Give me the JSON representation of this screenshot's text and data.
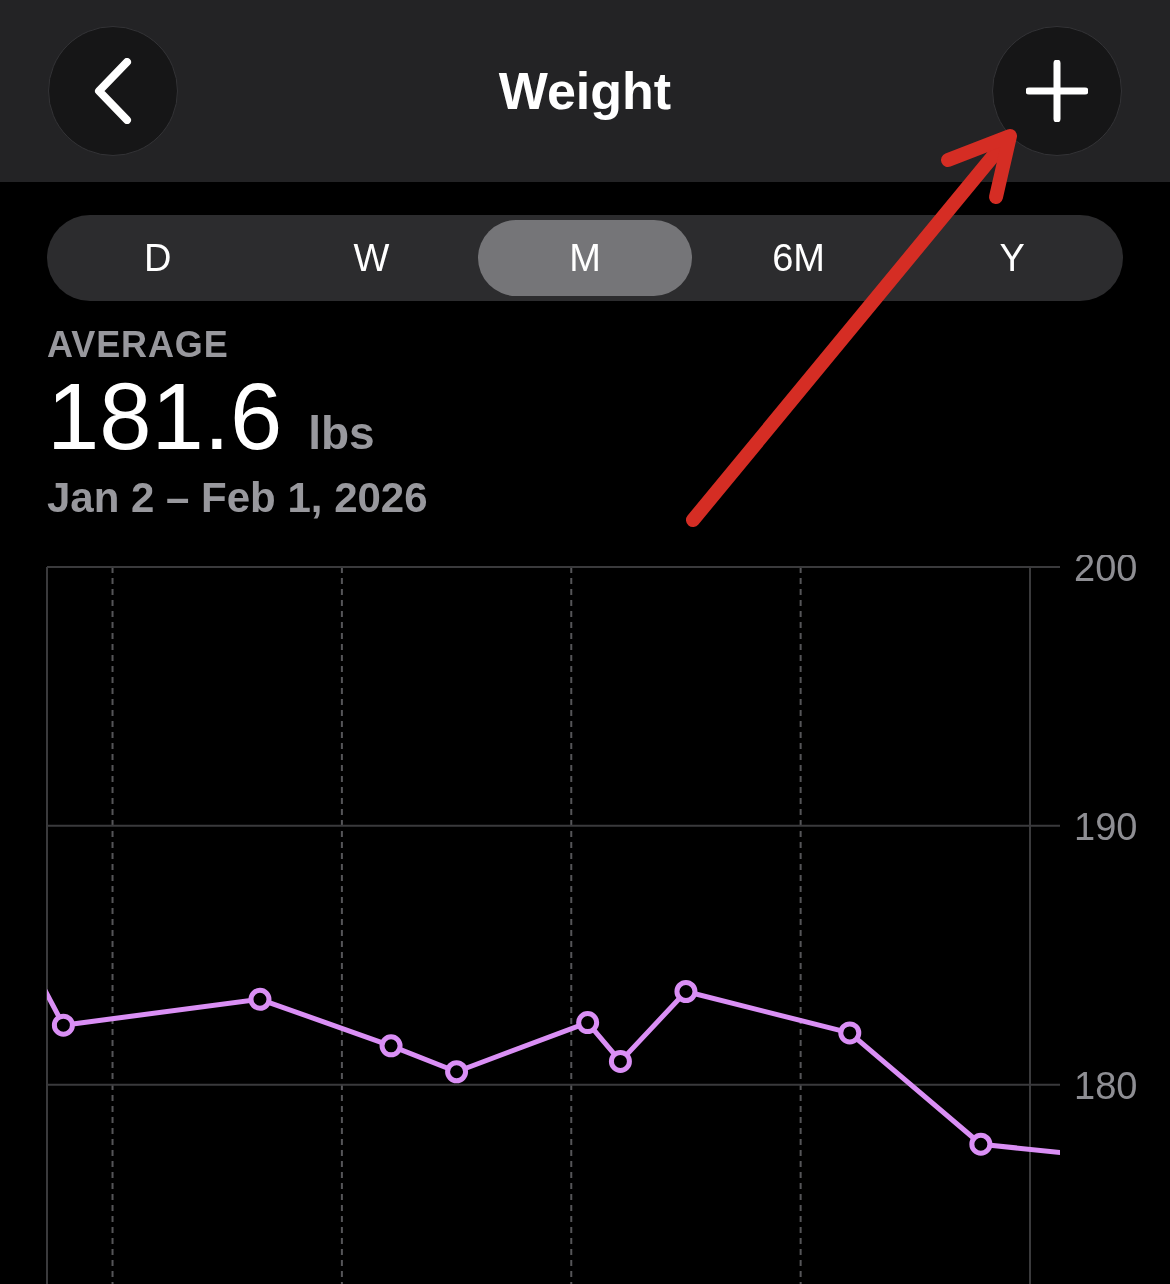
{
  "header": {
    "title": "Weight"
  },
  "ranges": [
    {
      "label": "D",
      "selected": false
    },
    {
      "label": "W",
      "selected": false
    },
    {
      "label": "M",
      "selected": true
    },
    {
      "label": "6M",
      "selected": false
    },
    {
      "label": "Y",
      "selected": false
    }
  ],
  "summary": {
    "label": "AVERAGE",
    "value": "181.6",
    "unit": "lbs",
    "date_range": "Jan 2 – Feb 1, 2026"
  },
  "chart": {
    "axis_labels": [
      "200",
      "190",
      "180"
    ]
  }
}
